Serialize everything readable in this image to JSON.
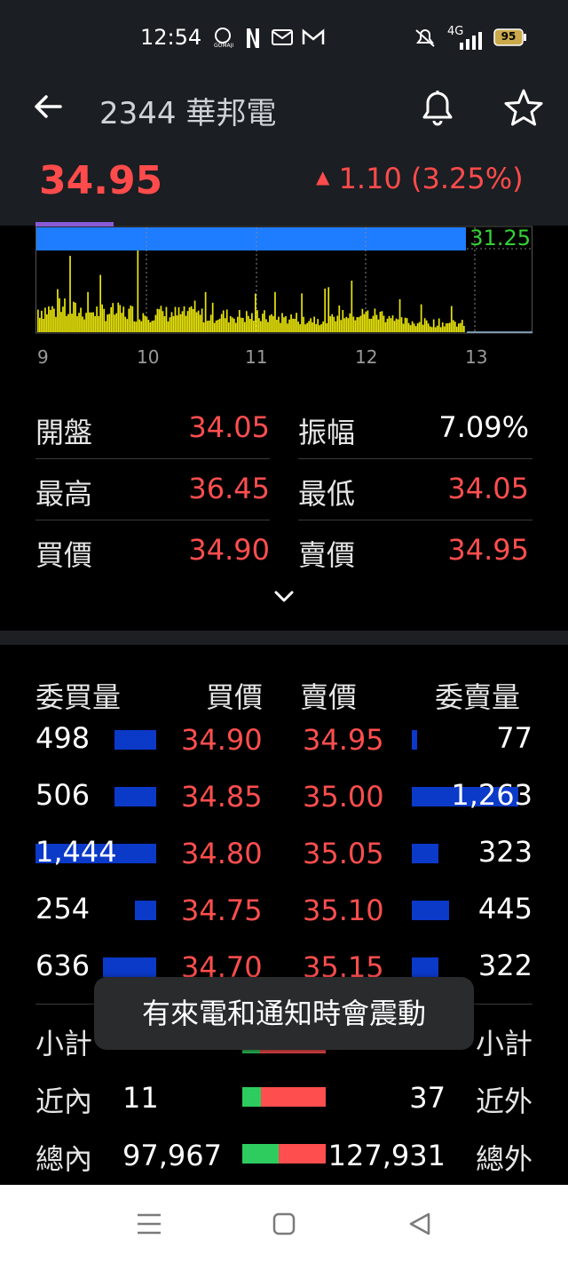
{
  "status": {
    "time": "12:54",
    "network": "4G",
    "battery": "95",
    "icons": [
      "gomaji-icon",
      "netflix-icon",
      "mail-icon",
      "gmail-icon",
      "mute-icon",
      "signal-icon",
      "battery-icon"
    ]
  },
  "header": {
    "title": "2344 華邦電",
    "price": "34.95",
    "change": "1.10 (3.25%)",
    "change_arrow": "▲"
  },
  "chart_data": {
    "type": "bar",
    "reference_price_label": "31.25",
    "x_ticks": [
      "9",
      "10",
      "11",
      "12",
      "13"
    ],
    "colors": {
      "volume": "#e8e40a",
      "price_band": "#1e7cff",
      "ref_label": "#35d135"
    }
  },
  "stats": {
    "left": [
      {
        "label": "開盤",
        "value": "34.05"
      },
      {
        "label": "最高",
        "value": "36.45"
      },
      {
        "label": "買價",
        "value": "34.90"
      }
    ],
    "right": [
      {
        "label": "振幅",
        "value": "7.09%"
      },
      {
        "label": "最低",
        "value": "34.05"
      },
      {
        "label": "賣價",
        "value": "34.95"
      }
    ]
  },
  "orderbook": {
    "headers": [
      "委買量",
      "買價",
      "賣價",
      "委賣量"
    ],
    "rows": [
      {
        "bid_vol": "498",
        "bid": "34.90",
        "ask": "34.95",
        "ask_vol": "77"
      },
      {
        "bid_vol": "506",
        "bid": "34.85",
        "ask": "35.00",
        "ask_vol": "1,263"
      },
      {
        "bid_vol": "1,444",
        "bid": "34.80",
        "ask": "35.05",
        "ask_vol": "323"
      },
      {
        "bid_vol": "254",
        "bid": "34.75",
        "ask": "35.10",
        "ask_vol": "445"
      },
      {
        "bid_vol": "636",
        "bid": "34.70",
        "ask": "35.15",
        "ask_vol": "322"
      }
    ]
  },
  "summary": {
    "subtotal_label": "小計",
    "near_in_label": "近內",
    "near_in": "11",
    "near_out": "37",
    "near_out_label": "近外",
    "total_in_label": "總內",
    "total_in": "97,967",
    "total_out": "127,931",
    "total_out_label": "總外"
  },
  "toast": "有來電和通知時會震動",
  "colors": {
    "up": "#ff4e4e",
    "down": "#2ecc5f",
    "bar_blue": "#0b39c8"
  }
}
